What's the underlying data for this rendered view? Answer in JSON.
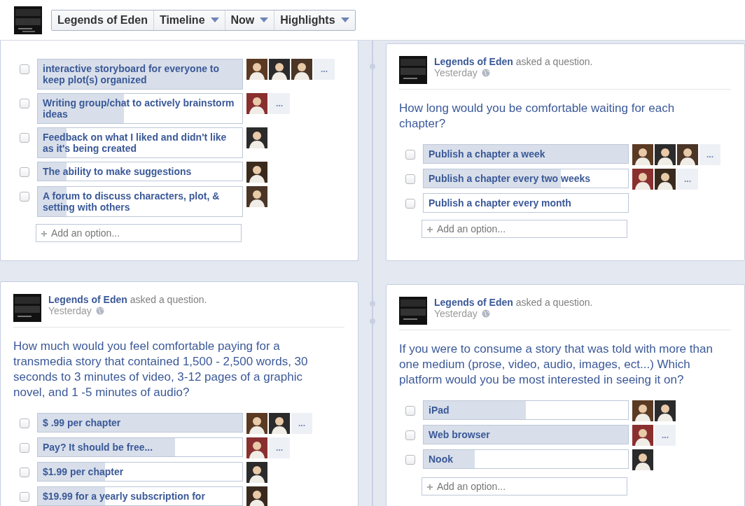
{
  "header": {
    "page_name": "Legends of Eden",
    "menus": [
      {
        "label": "Timeline"
      },
      {
        "label": "Now"
      },
      {
        "label": "Highlights"
      }
    ]
  },
  "posts": [
    {
      "options": [
        {
          "text": "interactive storyboard for everyone to keep plot(s) organized",
          "checked": false,
          "level": 1,
          "avatars": [
            {
              "kind": "picture"
            },
            {
              "kind": "picture"
            },
            {
              "kind": "picture"
            }
          ],
          "more": "..."
        },
        {
          "text": "Writing group/chat to actively brainstorm ideas",
          "checked": false,
          "level": 0.42,
          "avatars": [
            {
              "kind": "picture"
            }
          ],
          "more": "..."
        },
        {
          "text": "Feedback on what I liked and didn't like as it's being created",
          "checked": false,
          "level": 0.14,
          "avatars": [
            {
              "kind": "picture"
            }
          ]
        },
        {
          "text": "The ability to make suggestions",
          "checked": false,
          "level": 0.14,
          "avatars": [
            {
              "kind": "picture"
            }
          ]
        },
        {
          "text": "A forum to discuss characters, plot, & setting with others",
          "checked": false,
          "level": 0.14,
          "avatars": [
            {
              "kind": "picture"
            }
          ]
        }
      ],
      "add_option": {
        "placeholder": "Add an option..."
      }
    },
    {
      "author": "Legends of Eden",
      "action": "asked a question.",
      "time": "Yesterday",
      "question": "How long would you be comfortable waiting for each chapter?",
      "options": [
        {
          "text": "Publish a chapter a week",
          "checked": false,
          "level": 1,
          "avatars": [
            {
              "kind": "picture"
            },
            {
              "kind": "picture"
            },
            {
              "kind": "picture"
            }
          ],
          "more": "..."
        },
        {
          "text": "Publish a chapter every two weeks",
          "checked": false,
          "level": 0.67,
          "avatars": [
            {
              "kind": "picture"
            },
            {
              "kind": "picture"
            }
          ],
          "more": "..."
        },
        {
          "text": "Publish a chapter every month",
          "checked": false
        }
      ],
      "add_option": {
        "placeholder": "Add an option..."
      }
    },
    {
      "author": "Legends of Eden",
      "action": "asked a question.",
      "time": "Yesterday",
      "question": "How much would you feel comfortable paying for a transmedia story that contained 1,500 - 2,500 words, 30 seconds to 3 minutes of video, 3-12 pages of a graphic novel, and 1 -5 minutes of audio?",
      "options": [
        {
          "text": "$ .99 per chapter",
          "checked": false,
          "level": 1,
          "avatars": [
            {
              "kind": "picture"
            },
            {
              "kind": "picture"
            }
          ],
          "more": "..."
        },
        {
          "text": "Pay? It should be free...",
          "checked": false,
          "level": 0.67,
          "avatars": [
            {
              "kind": "picture"
            }
          ],
          "more": "..."
        },
        {
          "text": "$1.99 per chapter",
          "checked": false,
          "level": 0.33,
          "avatars": [
            {
              "kind": "picture"
            }
          ]
        },
        {
          "text": "$19.99 for a yearly subscription for",
          "checked": false,
          "level": 0.33,
          "avatars": [
            {
              "kind": "picture"
            }
          ]
        }
      ]
    },
    {
      "author": "Legends of Eden",
      "action": "asked a question.",
      "time": "Yesterday",
      "question": "If you were to consume a story that was told with more than one medium (prose, video, audio, images, ect...) Which platform would you be most interested in seeing it on?",
      "options": [
        {
          "text": "iPad",
          "checked": false,
          "level": 0.5,
          "avatars": [
            {
              "kind": "picture"
            },
            {
              "kind": "picture"
            }
          ]
        },
        {
          "text": "Web browser",
          "checked": false,
          "level": 1,
          "avatars": [
            {
              "kind": "picture"
            }
          ],
          "more": "..."
        },
        {
          "text": "Nook",
          "checked": false,
          "level": 0.25,
          "avatars": [
            {
              "kind": "picture"
            }
          ]
        }
      ],
      "add_option": {
        "placeholder": "Add an option..."
      }
    }
  ]
}
